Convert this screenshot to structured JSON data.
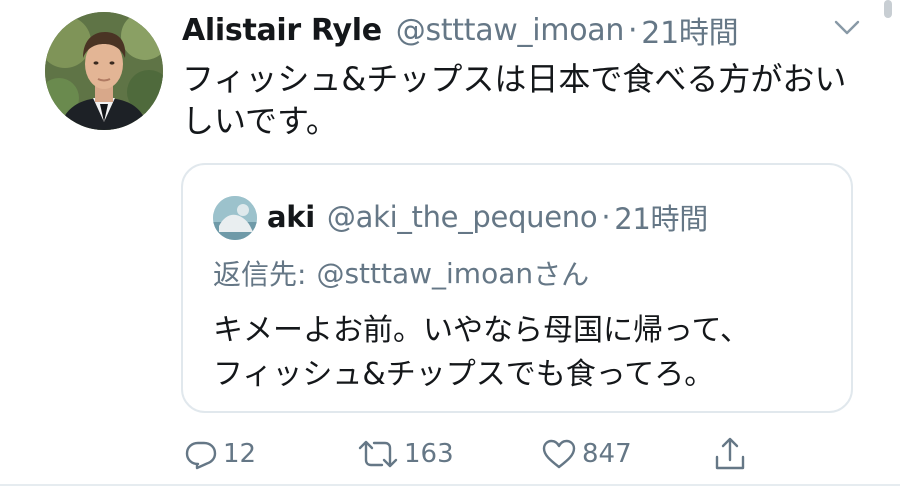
{
  "tweet": {
    "author": {
      "name": "Alistair Ryle",
      "handle": "@stttaw_imoan"
    },
    "separator": "·",
    "time": "21時間",
    "text": "フィッシュ&チップスは日本で食べる方がおいしいです。",
    "menu_icon": "chevron-down-icon"
  },
  "quoted_tweet": {
    "author": {
      "name": "aki",
      "handle": "@aki_the_pequeno"
    },
    "separator": "·",
    "time": "21時間",
    "reply_prefix": "返信先:",
    "reply_handle": "@stttaw_imoan",
    "reply_suffix": "さん",
    "text_line1": "キメーよお前。いやなら母国に帰って、",
    "text_line2": "フィッシュ&チップスでも食ってろ。"
  },
  "actions": {
    "reply": {
      "icon": "reply-icon",
      "count": "12"
    },
    "retweet": {
      "icon": "retweet-icon",
      "count": "163"
    },
    "like": {
      "icon": "heart-icon",
      "count": "847"
    },
    "share": {
      "icon": "share-icon"
    }
  },
  "colors": {
    "text_primary": "#14171a",
    "text_secondary": "#657786",
    "border": "#e1e8ed",
    "background": "#ffffff"
  }
}
